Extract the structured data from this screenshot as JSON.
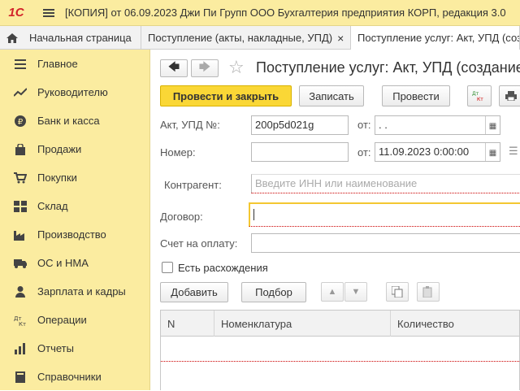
{
  "window": {
    "logo": "1С",
    "title": "[КОПИЯ] от 06.09.2023 Джи Пи Групп ООО Бухгалтерия предприятия КОРП, редакция 3.0"
  },
  "tabs": [
    {
      "label": "Начальная страница"
    },
    {
      "label": "Поступление (акты, накладные, УПД)",
      "close": "×"
    },
    {
      "label": "Поступление услуг: Акт, УПД (создание)"
    }
  ],
  "sidebar": {
    "items": [
      {
        "label": "Главное",
        "icon": "menu-icon"
      },
      {
        "label": "Руководителю",
        "icon": "trend-icon"
      },
      {
        "label": "Банк и касса",
        "icon": "ruble-icon"
      },
      {
        "label": "Продажи",
        "icon": "bag-icon"
      },
      {
        "label": "Покупки",
        "icon": "cart-icon"
      },
      {
        "label": "Склад",
        "icon": "warehouse-icon"
      },
      {
        "label": "Производство",
        "icon": "factory-icon"
      },
      {
        "label": "ОС и НМА",
        "icon": "truck-icon"
      },
      {
        "label": "Зарплата и кадры",
        "icon": "person-icon"
      },
      {
        "label": "Операции",
        "icon": "dt-kt-icon"
      },
      {
        "label": "Отчеты",
        "icon": "report-icon"
      },
      {
        "label": "Справочники",
        "icon": "book-icon"
      }
    ]
  },
  "document": {
    "title": "Поступление услуг: Акт, УПД (создание)",
    "toolbar": {
      "post_close": "Провести и закрыть",
      "save": "Записать",
      "post": "Провести",
      "dtkt": "Дт Кт"
    },
    "fields": {
      "act_label": "Акт, УПД №:",
      "act_value": "200p5d021g",
      "from_label": "от:",
      "act_date": " .  .",
      "number_label": "Номер:",
      "number_value": "",
      "from_label2": "от:",
      "date_value": "11.09.2023  0:00:00",
      "contractor_label": "Контрагент:",
      "contractor_placeholder": "Введите ИНН или наименование",
      "contract_label": "Договор:",
      "contract_value": "",
      "invoice_label": "Счет на оплату:",
      "invoice_value": "",
      "discrepancy_label": "Есть расхождения",
      "discrepancy_checked": false
    },
    "table_toolbar": {
      "add": "Добавить",
      "select": "Подбор"
    },
    "table": {
      "columns": [
        "N",
        "Номенклатура",
        "Количество"
      ]
    }
  },
  "colors": {
    "sidebar_bg": "#fbeca0",
    "primary_button": "#fad736",
    "logo_red": "#d2232a"
  }
}
